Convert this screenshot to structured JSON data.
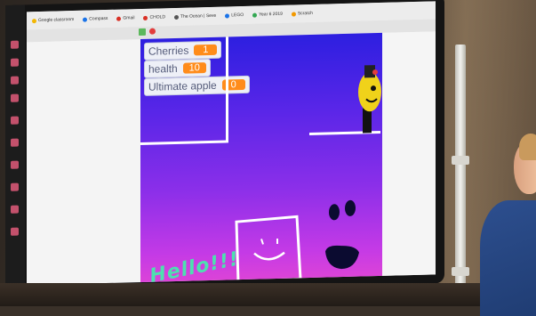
{
  "bookmarks": [
    "Google classroom",
    "Compass",
    "Gmail",
    "CHOLD",
    "The Ocean | Seve",
    "LEGO",
    "Year 6 2019",
    "Scratch"
  ],
  "stage": {
    "variables": [
      {
        "name": "Cherries",
        "value": "1"
      },
      {
        "name": "health",
        "value": "10"
      },
      {
        "name": "Ultimate apple",
        "value": "0"
      }
    ],
    "drawing_text": "Hello!!!"
  },
  "colors": {
    "stage_top": "#2d1fe0",
    "stage_bottom": "#e547d2",
    "variable_value": "#ff8c1a",
    "hello_text": "#4de0b0",
    "character_yellow": "#f0d21a"
  }
}
